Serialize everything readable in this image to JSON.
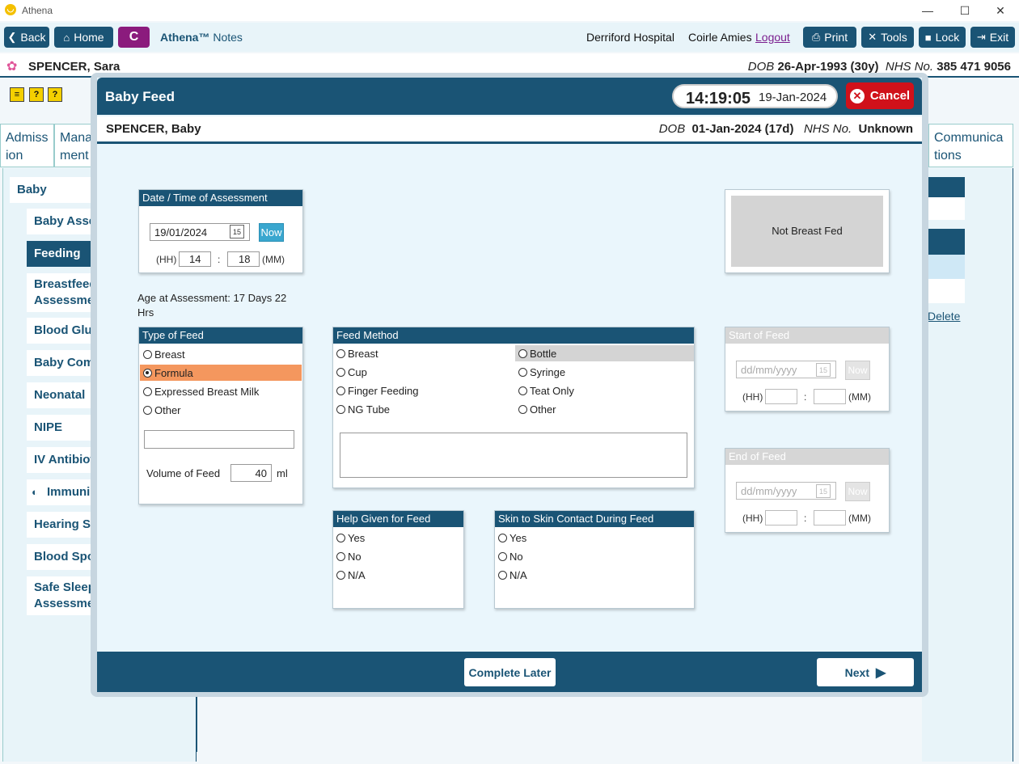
{
  "window": {
    "title": "Athena",
    "minimize": "—",
    "maximize": "☐",
    "close": "✕"
  },
  "nav": {
    "back": "Back",
    "home": "Home",
    "c": "C",
    "app_name": "Athena™",
    "app_sub": "Notes",
    "hospital": "Derriford Hospital",
    "user": "Coirle Amies",
    "logout": "Logout",
    "print": "Print",
    "tools": "Tools",
    "lock": "Lock",
    "exit": "Exit"
  },
  "patient": {
    "name": "SPENCER, Sara",
    "dob_label": "DOB",
    "dob": "26-Apr-1993 (30y)",
    "nhs_label": "NHS No.",
    "nhs": "385 471 9056"
  },
  "background": {
    "tabs": [
      "Admiss ion",
      "Mana ment",
      "Communica tions"
    ],
    "left_nav": [
      "Baby",
      "Baby Asses",
      "Feeding",
      "Breastfeedi Assessmen",
      "Blood Gluc",
      "Baby Comr",
      "Neonatal",
      "NIPE",
      "IV Antibiot",
      "Immunis",
      "Hearing Sc",
      "Blood Spot",
      "Safe Sleepi Assessmen"
    ],
    "delete_link": "Delete"
  },
  "modal": {
    "title": "Baby Feed",
    "time": "14:19:05",
    "date": "19-Jan-2024",
    "cancel": "Cancel",
    "baby_name": "SPENCER, Baby",
    "baby_dob_label": "DOB",
    "baby_dob": "01-Jan-2024 (17d)",
    "baby_nhs_label": "NHS No.",
    "baby_nhs": "Unknown",
    "assessment": {
      "header": "Date / Time of Assessment",
      "date": "19/01/2024",
      "now": "Now",
      "hh_label": "(HH)",
      "hh": "14",
      "mm_label": "(MM)",
      "mm": "18",
      "sep": ":"
    },
    "not_breast_fed": "Not Breast Fed",
    "age_text": "Age at Assessment: 17 Days  22 Hrs",
    "type_of_feed": {
      "header": "Type of Feed",
      "options": [
        "Breast",
        "Formula",
        "Expressed Breast Milk",
        "Other"
      ],
      "selected": "Formula",
      "volume_label": "Volume of Feed",
      "volume": "40",
      "unit": "ml"
    },
    "feed_method": {
      "header": "Feed Method",
      "left": [
        "Breast",
        "Cup",
        "Finger Feeding",
        "NG Tube"
      ],
      "right": [
        "Bottle",
        "Syringe",
        "Teat Only",
        "Other"
      ]
    },
    "start_of_feed": {
      "header": "Start of Feed",
      "placeholder": "dd/mm/yyyy",
      "now": "Now",
      "hh_label": "(HH)",
      "mm_label": "(MM)",
      "sep": ":"
    },
    "end_of_feed": {
      "header": "End of Feed",
      "placeholder": "dd/mm/yyyy",
      "now": "Now",
      "hh_label": "(HH)",
      "mm_label": "(MM)",
      "sep": ":"
    },
    "help_given": {
      "header": "Help Given for Feed",
      "options": [
        "Yes",
        "No",
        "N/A"
      ]
    },
    "skin_to_skin": {
      "header": "Skin to Skin Contact During Feed",
      "options": [
        "Yes",
        "No",
        "N/A"
      ]
    },
    "complete_later": "Complete Later",
    "next": "Next"
  },
  "colors": {
    "primary": "#1a5475",
    "cancel": "#d0111a",
    "selected": "#f4975e",
    "c_button": "#8b1b7d"
  }
}
